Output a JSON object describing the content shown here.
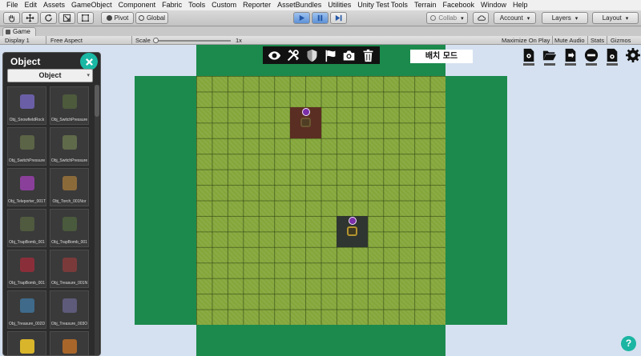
{
  "menu": [
    "File",
    "Edit",
    "Assets",
    "GameObject",
    "Component",
    "Fabric",
    "Tools",
    "Custom",
    "Reporter",
    "AssetBundles",
    "Utilities",
    "Unity Test Tools",
    "Terrain",
    "Facebook",
    "Window",
    "Help"
  ],
  "toolbar": {
    "pivot_label": "Pivot",
    "global_label": "Global",
    "collab_label": "Collab",
    "account_label": "Account",
    "layers_label": "Layers",
    "layout_label": "Layout"
  },
  "game_tab": {
    "label": "Game"
  },
  "game_bar": {
    "display": "Display 1",
    "aspect": "Free Aspect",
    "scale_label": "Scale",
    "scale_value": "1x",
    "maximize": "Maximize On Play",
    "mute": "Mute Audio",
    "stats": "Stats",
    "gizmos": "Gizmos"
  },
  "view": {
    "mode_label": "배치 모드",
    "top_icons": [
      "eye-icon",
      "tools-icon",
      "shield-icon",
      "flag-icon",
      "camera-icon",
      "trash-icon"
    ],
    "right_icons": [
      "settings-doc-icon",
      "folder-icon",
      "export-icon",
      "minus-icon",
      "settings-doc-icon",
      "gear-icon"
    ],
    "help_label": "?"
  },
  "object_panel": {
    "title": "Object",
    "category": "Object",
    "items": [
      {
        "label": "Obj_SnowfieldRock",
        "color": "#6a5fa6"
      },
      {
        "label": "Obj_SwitchPressure",
        "color": "#4d5a3c"
      },
      {
        "label": "Obj_SwitchPressure",
        "color": "#5b6446"
      },
      {
        "label": "Obj_SwitchPressure",
        "color": "#5f6a4a"
      },
      {
        "label": "Obj_Teleporter_001T",
        "color": "#8a3f9a"
      },
      {
        "label": "Obj_Torch_001Nor",
        "color": "#8b6a3a"
      },
      {
        "label": "Obj_TrapBomb_001",
        "color": "#505a3e"
      },
      {
        "label": "Obj_TrapBomb_001",
        "color": "#4a5a3c"
      },
      {
        "label": "Obj_TrapBomb_001",
        "color": "#8a2f3a"
      },
      {
        "label": "Obj_Treasure_001N",
        "color": "#7a3a3a"
      },
      {
        "label": "Obj_Treasure_002D",
        "color": "#3f6a8a"
      },
      {
        "label": "Obj_Treasure_003O",
        "color": "#5d5a7a"
      },
      {
        "label": "",
        "color": "#d8b52a"
      },
      {
        "label": "",
        "color": "#a8662a"
      }
    ]
  }
}
